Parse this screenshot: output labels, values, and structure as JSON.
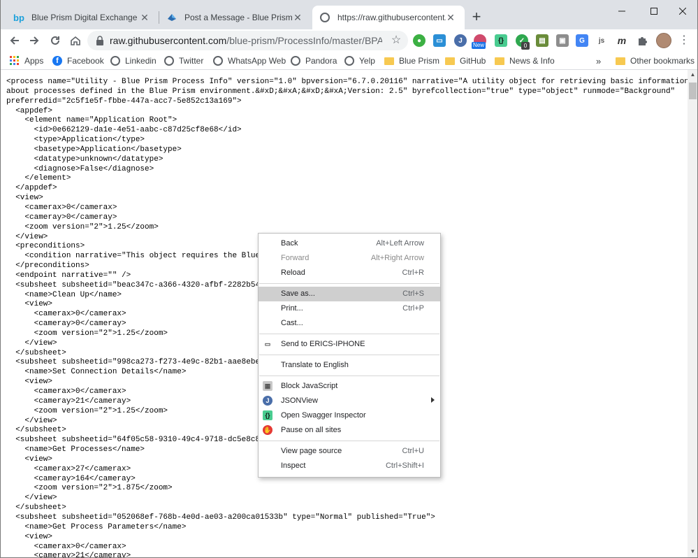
{
  "tabs": [
    {
      "title": "Blue Prism Digital Exchange",
      "favicon": "bp-logo-icon"
    },
    {
      "title": "Post a Message - Blue Prism Com",
      "favicon": "community-icon"
    },
    {
      "title": "https://raw.githubusercontent.co",
      "favicon": "globe-icon"
    }
  ],
  "new_tab_glyph": "+",
  "address_bar": {
    "host": "raw.githubusercontent.com",
    "path": "/blue-prism/ProcessInfo/master/BPA%..."
  },
  "extensions": [
    "green-extension",
    "screen-extension",
    "jsonview-extension",
    "new-extension",
    "swagger-extension",
    "adblock-extension",
    "doc-extension",
    "translate-extension",
    "js-extension",
    "m-extension",
    "puzzle-extension"
  ],
  "extension_badges": {
    "new": "New",
    "count": "0"
  },
  "bookmarks": {
    "apps": "Apps",
    "items": [
      "Facebook",
      "Linkedin",
      "Twitter",
      "WhatsApp Web",
      "Pandora",
      "Yelp",
      "Blue Prism",
      "GitHub",
      "News & Info"
    ],
    "overflow": "»",
    "other": "Other bookmarks"
  },
  "xml_lines": [
    "<process name=\"Utility - Blue Prism Process Info\" version=\"1.0\" bpversion=\"6.7.0.20116\" narrative=\"A utility object for retrieving basic information",
    "about processes defined in the Blue Prism environment.&#xD;&#xA;&#xD;&#xA;Version: 2.5\" byrefcollection=\"true\" type=\"object\" runmode=\"Background\"",
    "preferredid=\"2c5f1e5f-fbbe-447a-acc7-5e852c13a169\">",
    "  <appdef>",
    "    <element name=\"Application Root\">",
    "      <id>0e662129-da1e-4e51-aabc-c87d25cf8e68</id>",
    "      <type>Application</type>",
    "      <basetype>Application</basetype>",
    "      <datatype>unknown</datatype>",
    "      <diagnose>False</diagnose>",
    "    </element>",
    "  </appdef>",
    "  <view>",
    "    <camerax>0</camerax>",
    "    <cameray>0</cameray>",
    "    <zoom version=\"2\">1.25</zoom>",
    "  </view>",
    "  <preconditions>",
    "    <condition narrative=\"This object requires the Blue",
    "  </preconditions>",
    "  <endpoint narrative=\"\" />",
    "  <subsheet subsheetid=\"beac347c-a366-4320-afbf-2282b54",
    "    <name>Clean Up</name>",
    "    <view>",
    "      <camerax>0</camerax>",
    "      <cameray>0</cameray>",
    "      <zoom version=\"2\">1.25</zoom>",
    "    </view>",
    "  </subsheet>",
    "  <subsheet subsheetid=\"998ca273-f273-4e9c-82b1-aae8ebe",
    "    <name>Set Connection Details</name>",
    "    <view>",
    "      <camerax>0</camerax>",
    "      <cameray>21</cameray>",
    "      <zoom version=\"2\">1.25</zoom>",
    "    </view>",
    "  </subsheet>",
    "  <subsheet subsheetid=\"64f05c58-9310-49c4-9718-dc5e8c8",
    "    <name>Get Processes</name>",
    "    <view>",
    "      <camerax>27</camerax>",
    "      <cameray>164</cameray>",
    "      <zoom version=\"2\">1.875</zoom>",
    "    </view>",
    "  </subsheet>",
    "  <subsheet subsheetid=\"052068ef-768b-4e0d-ae03-a200ca01533b\" type=\"Normal\" published=\"True\">",
    "    <name>Get Process Parameters</name>",
    "    <view>",
    "      <camerax>0</camerax>",
    "      <cameray>21</cameray>"
  ],
  "context_menu": [
    {
      "type": "item",
      "label": "Back",
      "shortcut": "Alt+Left Arrow",
      "disabled": false
    },
    {
      "type": "item",
      "label": "Forward",
      "shortcut": "Alt+Right Arrow",
      "disabled": true
    },
    {
      "type": "item",
      "label": "Reload",
      "shortcut": "Ctrl+R",
      "disabled": false
    },
    {
      "type": "sep"
    },
    {
      "type": "item",
      "label": "Save as...",
      "shortcut": "Ctrl+S",
      "highlighted": true
    },
    {
      "type": "item",
      "label": "Print...",
      "shortcut": "Ctrl+P"
    },
    {
      "type": "item",
      "label": "Cast...",
      "shortcut": ""
    },
    {
      "type": "sep"
    },
    {
      "type": "item",
      "label": "Send to ERICS-IPHONE",
      "shortcut": "",
      "icon": "device-icon"
    },
    {
      "type": "sep"
    },
    {
      "type": "item",
      "label": "Translate to English",
      "shortcut": ""
    },
    {
      "type": "sep"
    },
    {
      "type": "item",
      "label": "Block JavaScript",
      "shortcut": "",
      "icon": "block-js-icon"
    },
    {
      "type": "item",
      "label": "JSONView",
      "shortcut": "",
      "icon": "jsonview-icon",
      "submenu": true
    },
    {
      "type": "item",
      "label": "Open Swagger Inspector",
      "shortcut": "",
      "icon": "swagger-icon"
    },
    {
      "type": "item",
      "label": "Pause on all sites",
      "shortcut": "",
      "icon": "adblock-icon"
    },
    {
      "type": "sep"
    },
    {
      "type": "item",
      "label": "View page source",
      "shortcut": "Ctrl+U"
    },
    {
      "type": "item",
      "label": "Inspect",
      "shortcut": "Ctrl+Shift+I"
    }
  ]
}
